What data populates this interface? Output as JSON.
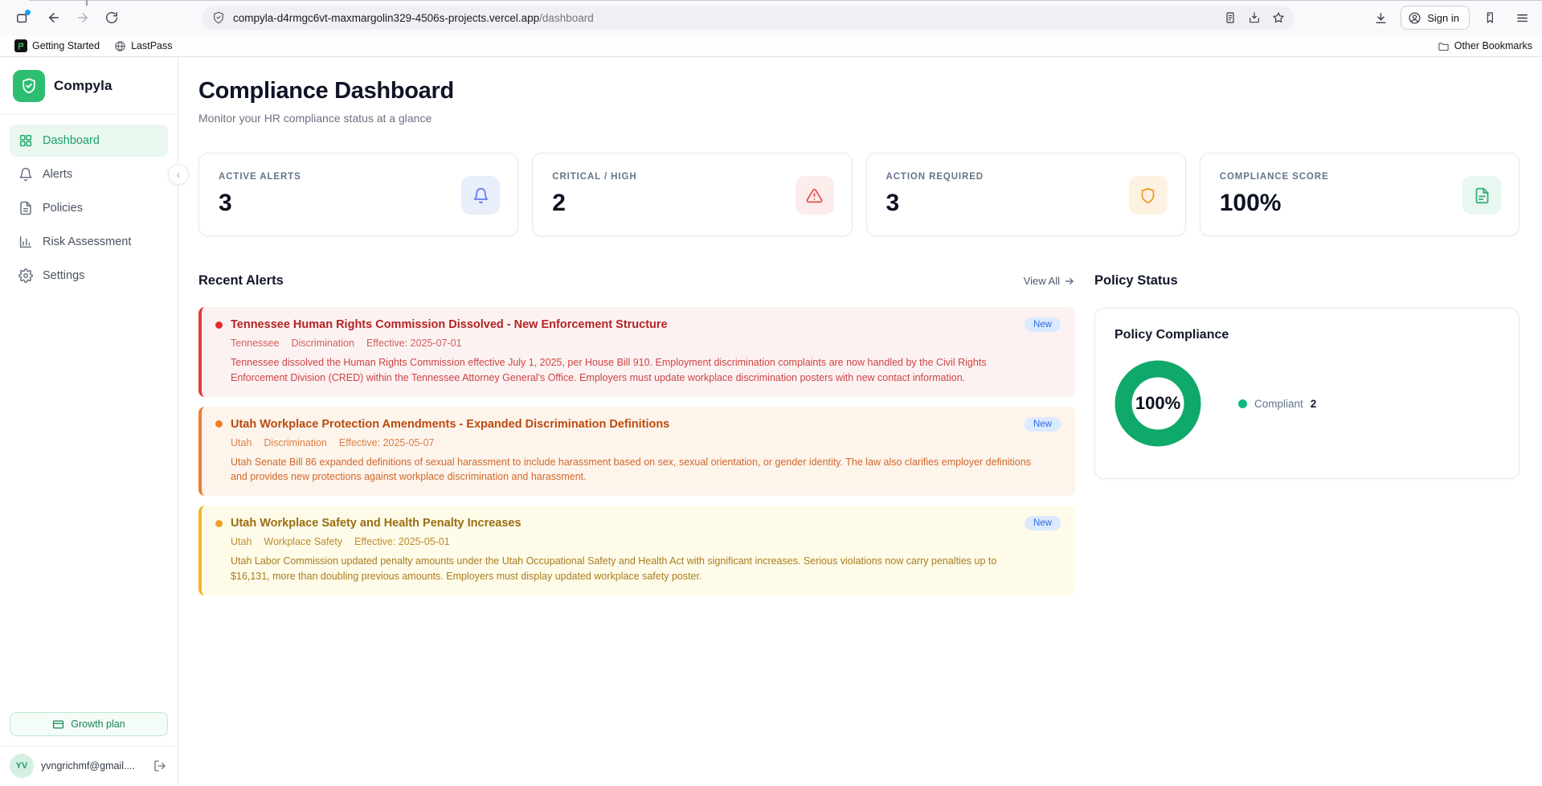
{
  "browser": {
    "url_host": "compyla-d4rmgc6vt-maxmargolin329-4506s-projects.vercel.app",
    "url_path": "/dashboard",
    "sign_in": "Sign in",
    "bookmarks": [
      {
        "label": "Getting Started"
      },
      {
        "label": "LastPass"
      }
    ],
    "other_bookmarks": "Other Bookmarks",
    "icons": [
      "firefox-view",
      "back",
      "forward",
      "reload",
      "shield-permissions",
      "reader-view",
      "save-page",
      "bookmark-star",
      "downloads",
      "account",
      "extension",
      "menu",
      "folder",
      "globe"
    ]
  },
  "sidebar": {
    "brand": "Compyla",
    "items": [
      {
        "label": "Dashboard",
        "icon": "grid-icon",
        "active": true
      },
      {
        "label": "Alerts",
        "icon": "bell-icon",
        "active": false
      },
      {
        "label": "Policies",
        "icon": "file-icon",
        "active": false
      },
      {
        "label": "Risk Assessment",
        "icon": "bar-chart-icon",
        "active": false
      },
      {
        "label": "Settings",
        "icon": "gear-icon",
        "active": false
      }
    ],
    "plan_label": "Growth plan",
    "user": {
      "initials": "YV",
      "email": "yvngrichmf@gmail...."
    }
  },
  "header": {
    "title": "Compliance Dashboard",
    "subtitle": "Monitor your HR compliance status at a glance"
  },
  "stats": [
    {
      "label": "ACTIVE ALERTS",
      "value": "3",
      "icon": "bell-icon",
      "accent": "#5d79f2",
      "bg": "#e9eefb"
    },
    {
      "label": "CRITICAL / HIGH",
      "value": "2",
      "icon": "alert-triangle-icon",
      "accent": "#e8504f",
      "bg": "#fdecec"
    },
    {
      "label": "ACTION REQUIRED",
      "value": "3",
      "icon": "shield-icon",
      "accent": "#eb9b27",
      "bg": "#fdf2e1"
    },
    {
      "label": "COMPLIANCE SCORE",
      "value": "100%",
      "icon": "file-text-icon",
      "accent": "#2fae74",
      "bg": "#e8f7ef"
    }
  ],
  "alerts_section": {
    "title": "Recent Alerts",
    "view_all": "View All",
    "items": [
      {
        "severity": "critical",
        "title": "Tennessee Human Rights Commission Dissolved - New Enforcement Structure",
        "badge": "New",
        "state": "Tennessee",
        "category": "Discrimination",
        "effective": "Effective: 2025-07-01",
        "body": "Tennessee dissolved the Human Rights Commission effective July 1, 2025, per House Bill 910. Employment discrimination complaints are now handled by the Civil Rights Enforcement Division (CRED) within the Tennessee Attorney General's Office. Employers must update workplace discrimination posters with new contact information."
      },
      {
        "severity": "high",
        "title": "Utah Workplace Protection Amendments - Expanded Discrimination Definitions",
        "badge": "New",
        "state": "Utah",
        "category": "Discrimination",
        "effective": "Effective: 2025-05-07",
        "body": "Utah Senate Bill 86 expanded definitions of sexual harassment to include harassment based on sex, sexual orientation, or gender identity. The law also clarifies employer definitions and provides new protections against workplace discrimination and harassment."
      },
      {
        "severity": "medium",
        "title": "Utah Workplace Safety and Health Penalty Increases",
        "badge": "New",
        "state": "Utah",
        "category": "Workplace Safety",
        "effective": "Effective: 2025-05-01",
        "body": "Utah Labor Commission updated penalty amounts under the Utah Occupational Safety and Health Act with significant increases. Serious violations now carry penalties up to $16,131, more than doubling previous amounts. Employers must display updated workplace safety poster."
      }
    ]
  },
  "policy": {
    "section_title": "Policy Status",
    "card_title": "Policy Compliance",
    "percent": "100%",
    "legend_label": "Compliant",
    "legend_value": "2",
    "ring_color": "#0fa96b"
  },
  "chart_data": {
    "type": "pie",
    "title": "Policy Compliance",
    "labels": [
      "Compliant"
    ],
    "values": [
      2
    ],
    "center_text": "100%",
    "colors": [
      "#0fa96b"
    ],
    "legend_position": "right",
    "donut": true
  }
}
